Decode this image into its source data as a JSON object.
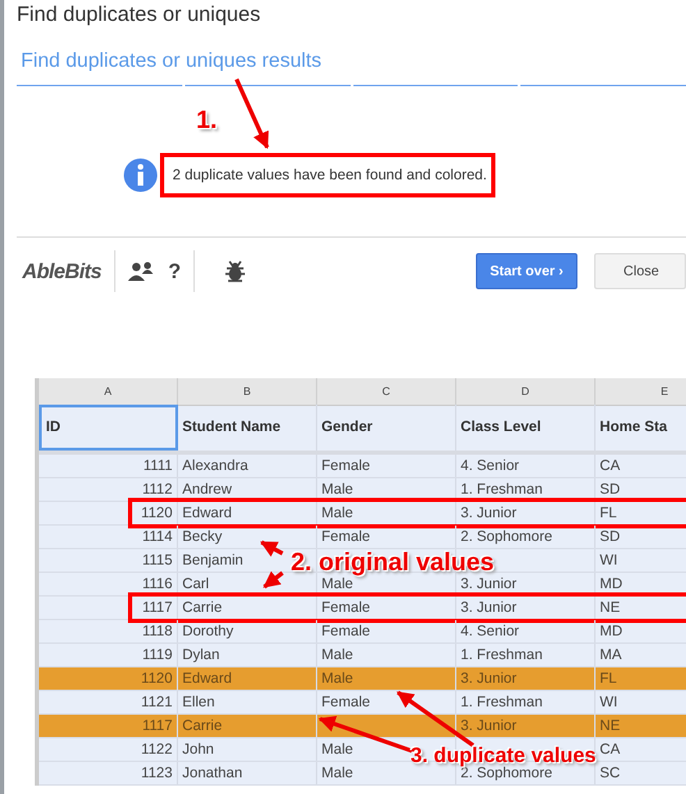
{
  "panel": {
    "title": "Find duplicates or uniques",
    "step_tab": {
      "label": "Find duplicates or uniques results",
      "selected": true
    },
    "message": {
      "text": "2 duplicate values have been found and colored.",
      "outlined": true
    }
  },
  "toolbar": {
    "logo": "AbleBits",
    "help": "?",
    "buttons": [
      {
        "label": "Start over ›",
        "kind": "primary"
      },
      {
        "label": "Close",
        "kind": "secondary"
      }
    ]
  },
  "sheet": {
    "column_letters": [
      "A",
      "B",
      "C",
      "D",
      "E"
    ],
    "header": [
      "ID",
      "Student Name",
      "Gender",
      "Class Level",
      "Home Sta"
    ],
    "rows": [
      {
        "cells": [
          "1111",
          "Alexandra",
          "Female",
          "4. Senior",
          "CA"
        ],
        "duplicate": false,
        "outlined": false
      },
      {
        "cells": [
          "1112",
          "Andrew",
          "Male",
          "1. Freshman",
          "SD"
        ],
        "duplicate": false,
        "outlined": false
      },
      {
        "cells": [
          "1120",
          "Edward",
          "Male",
          "3. Junior",
          "FL"
        ],
        "duplicate": false,
        "outlined": true
      },
      {
        "cells": [
          "1114",
          "Becky",
          "Female",
          "2. Sophomore",
          "SD"
        ],
        "duplicate": false,
        "outlined": false
      },
      {
        "cells": [
          "1115",
          "Benjamin",
          null,
          null,
          "WI"
        ],
        "duplicate": false,
        "outlined": false
      },
      {
        "cells": [
          "1116",
          "Carl",
          "Male",
          "3. Junior",
          "MD"
        ],
        "duplicate": false,
        "outlined": false
      },
      {
        "cells": [
          "1117",
          "Carrie",
          "Female",
          "3. Junior",
          "NE"
        ],
        "duplicate": false,
        "outlined": true
      },
      {
        "cells": [
          "1118",
          "Dorothy",
          "Female",
          "4. Senior",
          "MD"
        ],
        "duplicate": false,
        "outlined": false
      },
      {
        "cells": [
          "1119",
          "Dylan",
          "Male",
          "1. Freshman",
          "MA"
        ],
        "duplicate": false,
        "outlined": false
      },
      {
        "cells": [
          "1120",
          "Edward",
          "Male",
          "3. Junior",
          "FL"
        ],
        "duplicate": true,
        "outlined": false
      },
      {
        "cells": [
          "1121",
          "Ellen",
          "Female",
          "1. Freshman",
          "WI"
        ],
        "duplicate": false,
        "outlined": false
      },
      {
        "cells": [
          "1117",
          "Carrie",
          null,
          "3. Junior",
          "NE"
        ],
        "duplicate": true,
        "outlined": false
      },
      {
        "cells": [
          "1122",
          "John",
          "Male",
          null,
          "CA"
        ],
        "duplicate": false,
        "outlined": false
      },
      {
        "cells": [
          "1123",
          "Jonathan",
          "Male",
          "2. Sophomore",
          "SC"
        ],
        "duplicate": false,
        "outlined": false
      }
    ]
  },
  "callouts": [
    "1.",
    "2. original values",
    "3. duplicate values"
  ]
}
